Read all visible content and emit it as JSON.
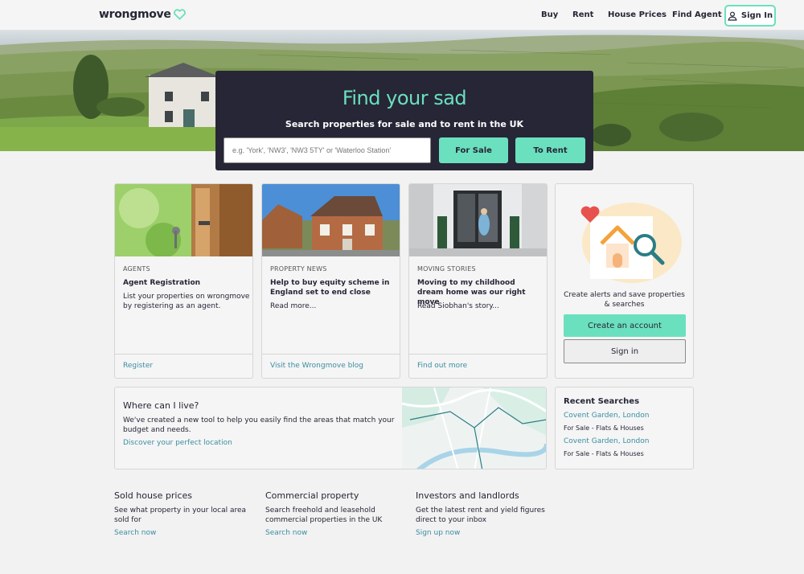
{
  "header": {
    "logo": "wrongmove",
    "nav": [
      "Buy",
      "Rent",
      "House Prices",
      "Find Agent"
    ],
    "signin": "Sign In"
  },
  "search": {
    "title": "Find your sad",
    "subtitle": "Search properties for sale and to rent in the UK",
    "placeholder": "e.g. 'York', 'NW3', 'NW3 5TY' or 'Waterloo Station'",
    "for_sale": "For Sale",
    "to_rent": "To Rent"
  },
  "cards": [
    {
      "category": "AGENTS",
      "title": "Agent Registration",
      "desc": "List your properties on wrongmove by registering as an agent.",
      "link": "Register"
    },
    {
      "category": "PROPERTY NEWS",
      "title": "Help to buy equity scheme in England set to end close",
      "desc": "Read more...",
      "link": "Visit the Wrongmove blog"
    },
    {
      "category": "MOVING STORIES",
      "title": "Moving to my childhood dream home was our right move",
      "desc": "Read Siobhan's story...",
      "link": "Find out more"
    }
  ],
  "account": {
    "text": "Create alerts and save properties & searches",
    "create": "Create an account",
    "signin": "Sign in"
  },
  "live": {
    "title": "Where can I live?",
    "desc": "We've created a new tool to help you easily find the areas that match your budget and needs.",
    "link": "Discover your perfect location"
  },
  "recent": {
    "title": "Recent Searches",
    "items": [
      {
        "place": "Covent Garden, London",
        "detail": "For Sale - Flats & Houses"
      },
      {
        "place": "Covent Garden, London",
        "detail": "For Sale - Flats & Houses"
      }
    ]
  },
  "footer": [
    {
      "title": "Sold house prices",
      "desc": "See what property in your local area sold for",
      "link": "Search now"
    },
    {
      "title": "Commercial property",
      "desc": "Search freehold and leasehold commercial properties in the UK",
      "link": "Search now"
    },
    {
      "title": "Investors and landlords",
      "desc": "Get the latest rent and yield figures direct to your inbox",
      "link": "Sign up now"
    }
  ],
  "colors": {
    "accent": "#6be0be",
    "dark": "#262637",
    "link": "#3a8ea1"
  }
}
